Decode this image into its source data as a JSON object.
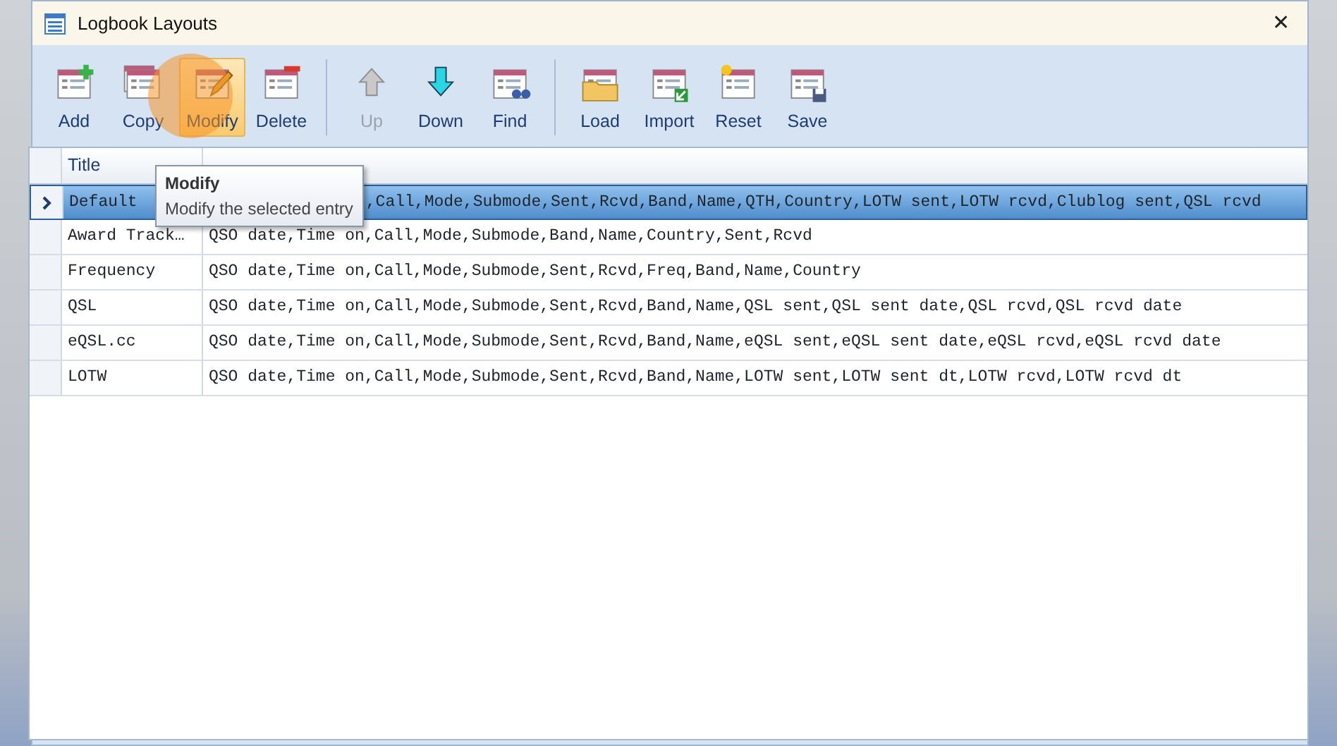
{
  "window": {
    "title": "Logbook Layouts",
    "close": "✕"
  },
  "toolbar": {
    "groups": [
      [
        {
          "label": "Add",
          "kind": "add",
          "disabled": false,
          "hovered": false
        },
        {
          "label": "Copy",
          "kind": "copy",
          "disabled": false,
          "hovered": false
        },
        {
          "label": "Modify",
          "kind": "modify",
          "disabled": false,
          "hovered": true
        },
        {
          "label": "Delete",
          "kind": "delete",
          "disabled": false,
          "hovered": false
        }
      ],
      [
        {
          "label": "Up",
          "kind": "up",
          "disabled": true,
          "hovered": false
        },
        {
          "label": "Down",
          "kind": "down",
          "disabled": false,
          "hovered": false
        },
        {
          "label": "Find",
          "kind": "find",
          "disabled": false,
          "hovered": false
        }
      ],
      [
        {
          "label": "Load",
          "kind": "load",
          "disabled": false,
          "hovered": false
        },
        {
          "label": "Import",
          "kind": "import",
          "disabled": false,
          "hovered": false
        },
        {
          "label": "Reset",
          "kind": "reset",
          "disabled": false,
          "hovered": false
        },
        {
          "label": "Save",
          "kind": "save",
          "disabled": false,
          "hovered": false
        }
      ]
    ]
  },
  "table": {
    "columns": [
      "Title"
    ],
    "rows": [
      {
        "title": "Default",
        "fields": ",Call,Mode,Submode,Sent,Rcvd,Band,Name,QTH,Country,LOTW sent,LOTW rcvd,Clublog sent,QSL rcvd",
        "selected": true,
        "under_tooltip": true
      },
      {
        "title": "Award Track…",
        "fields": "QSO date,Time on,Call,Mode,Submode,Band,Name,Country,Sent,Rcvd",
        "selected": false,
        "under_tooltip": false
      },
      {
        "title": "Frequency",
        "fields": "QSO date,Time on,Call,Mode,Submode,Sent,Rcvd,Freq,Band,Name,Country",
        "selected": false,
        "under_tooltip": false
      },
      {
        "title": "QSL",
        "fields": "QSO date,Time on,Call,Mode,Submode,Sent,Rcvd,Band,Name,QSL sent,QSL sent date,QSL rcvd,QSL rcvd date",
        "selected": false,
        "under_tooltip": false
      },
      {
        "title": "eQSL.cc",
        "fields": "QSO date,Time on,Call,Mode,Submode,Sent,Rcvd,Band,Name,eQSL sent,eQSL sent date,eQSL rcvd,eQSL rcvd date",
        "selected": false,
        "under_tooltip": false
      },
      {
        "title": "LOTW",
        "fields": "QSO date,Time on,Call,Mode,Submode,Sent,Rcvd,Band,Name,LOTW sent,LOTW sent dt,LOTW rcvd,LOTW rcvd dt",
        "selected": false,
        "under_tooltip": false
      }
    ]
  },
  "tooltip": {
    "title": "Modify",
    "text": "Modify the selected entry"
  }
}
